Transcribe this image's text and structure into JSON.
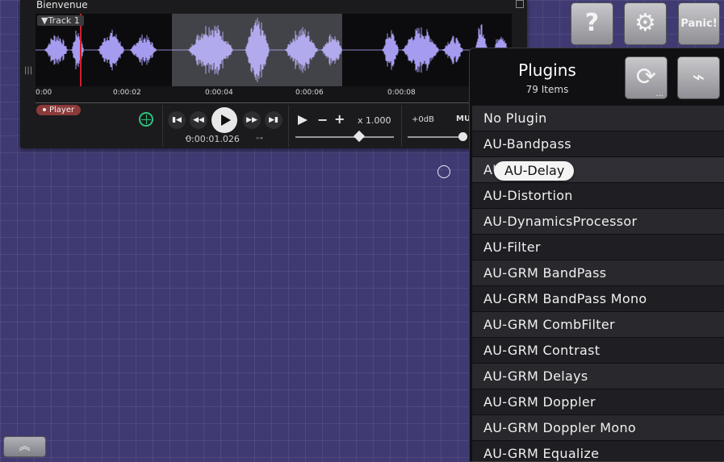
{
  "player": {
    "title": "Bienvenue",
    "track_label": "▼Track 1",
    "badge": "Player",
    "timeline_ticks": [
      "0:00",
      "0:00:02",
      "0:00:04",
      "0:00:06",
      "0:00:08"
    ],
    "position": "0:00:01.026",
    "rate": "x 1.000",
    "gain": "+0dB",
    "mute": "MU"
  },
  "top_buttons": {
    "help": "?",
    "gear": "⚙",
    "panic": "Panic!"
  },
  "plugins": {
    "title": "Plugins",
    "count": "79 Items",
    "refresh_glyph": "⟳",
    "refresh_dots": "...",
    "curve_glyph": "⌁",
    "tooltip": "AU-Delay",
    "items": [
      "No Plugin",
      "AU-Bandpass",
      "AU-Delay",
      "AU-Distortion",
      "AU-DynamicsProcessor",
      "AU-Filter",
      "AU-GRM BandPass",
      "AU-GRM BandPass Mono",
      "AU-GRM CombFilter",
      "AU-GRM Contrast",
      "AU-GRM Delays",
      "AU-GRM Doppler",
      "AU-GRM Doppler Mono",
      "AU-GRM Equalize"
    ]
  },
  "expand_glyph": "︽",
  "colors": {
    "background": "#3f3a72",
    "waveform": "#a59cf0",
    "playhead": "#d0202a",
    "sync": "#2ec27e"
  }
}
